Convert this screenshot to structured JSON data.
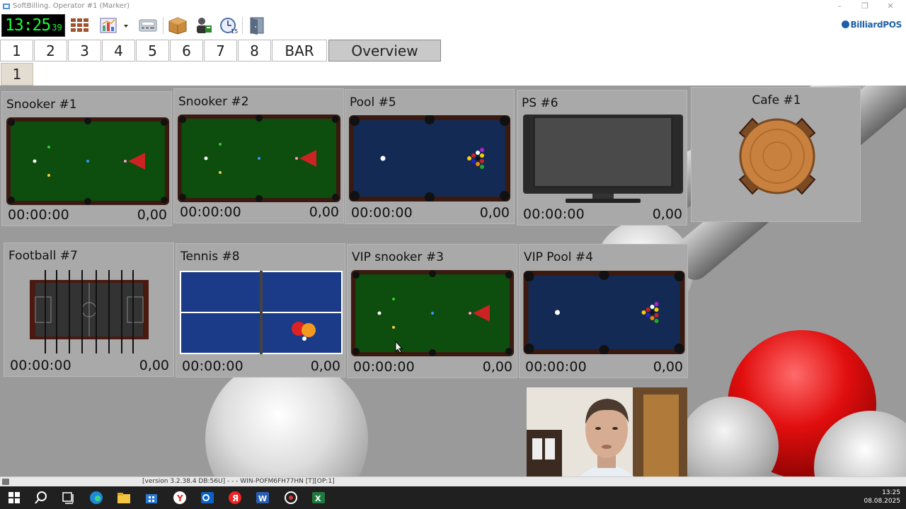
{
  "window": {
    "title": "SoftBilling. Operator #1 (Marker)",
    "controls": {
      "minimize": "–",
      "restore": "❐",
      "close": "✕"
    }
  },
  "toolbar": {
    "clock": {
      "hhmm": "13:25",
      "seconds": "39"
    },
    "icons": [
      "tables-grid-icon",
      "report-chart-icon",
      "dropdown-arrow-icon",
      "cash-register-icon",
      "product-box-icon",
      "staff-icon",
      "reservation-clock-icon",
      "exit-door-icon"
    ],
    "brand": "BilliardPOS"
  },
  "tabs": [
    {
      "label": "1"
    },
    {
      "label": "2"
    },
    {
      "label": "3"
    },
    {
      "label": "4"
    },
    {
      "label": "5"
    },
    {
      "label": "6"
    },
    {
      "label": "7"
    },
    {
      "label": "8"
    },
    {
      "label": "BAR"
    },
    {
      "label": "Overview",
      "active": true
    }
  ],
  "subtab": {
    "label": "1"
  },
  "tiles": [
    {
      "name": "Snooker #1",
      "time": "00:00:00",
      "price": "0,00",
      "type": "snooker"
    },
    {
      "name": "Snooker #2",
      "time": "00:00:00",
      "price": "0,00",
      "type": "snooker"
    },
    {
      "name": "Pool #5",
      "time": "00:00:00",
      "price": "0,00",
      "type": "pool"
    },
    {
      "name": "PS #6",
      "time": "00:00:00",
      "price": "0,00",
      "type": "tv"
    },
    {
      "name": "Cafe #1",
      "type": "cafe"
    },
    {
      "name": "Football #7",
      "time": "00:00:00",
      "price": "0,00",
      "type": "foosball"
    },
    {
      "name": "Tennis #8",
      "time": "00:00:00",
      "price": "0,00",
      "type": "tennis"
    },
    {
      "name": "VIP snooker #3",
      "time": "00:00:00",
      "price": "0,00",
      "type": "snooker"
    },
    {
      "name": "VIP Pool #4",
      "time": "00:00:00",
      "price": "0,00",
      "type": "pool"
    }
  ],
  "statusbar": {
    "version": "[version 3.2.38.4 DB:56U]  - - - WIN-POFM6FH77HN [T][OP:1]"
  },
  "taskbar": {
    "apps": [
      "start-icon",
      "search-icon",
      "task-view-icon",
      "edge-icon",
      "file-explorer-icon",
      "store-icon",
      "yandex-browser-icon",
      "outlook-icon",
      "yandex-icon",
      "word-icon",
      "app-icon",
      "excel-icon"
    ],
    "time": "13:25",
    "date": "08.08.2025"
  },
  "colors": {
    "snooker_felt": "#0d4d0d",
    "pool_felt": "#132a55",
    "tennis_table": "#1b3a88",
    "rail": "#3a1a10",
    "clock_digits": "#19ff3a",
    "brand": "#1d5fa8"
  }
}
